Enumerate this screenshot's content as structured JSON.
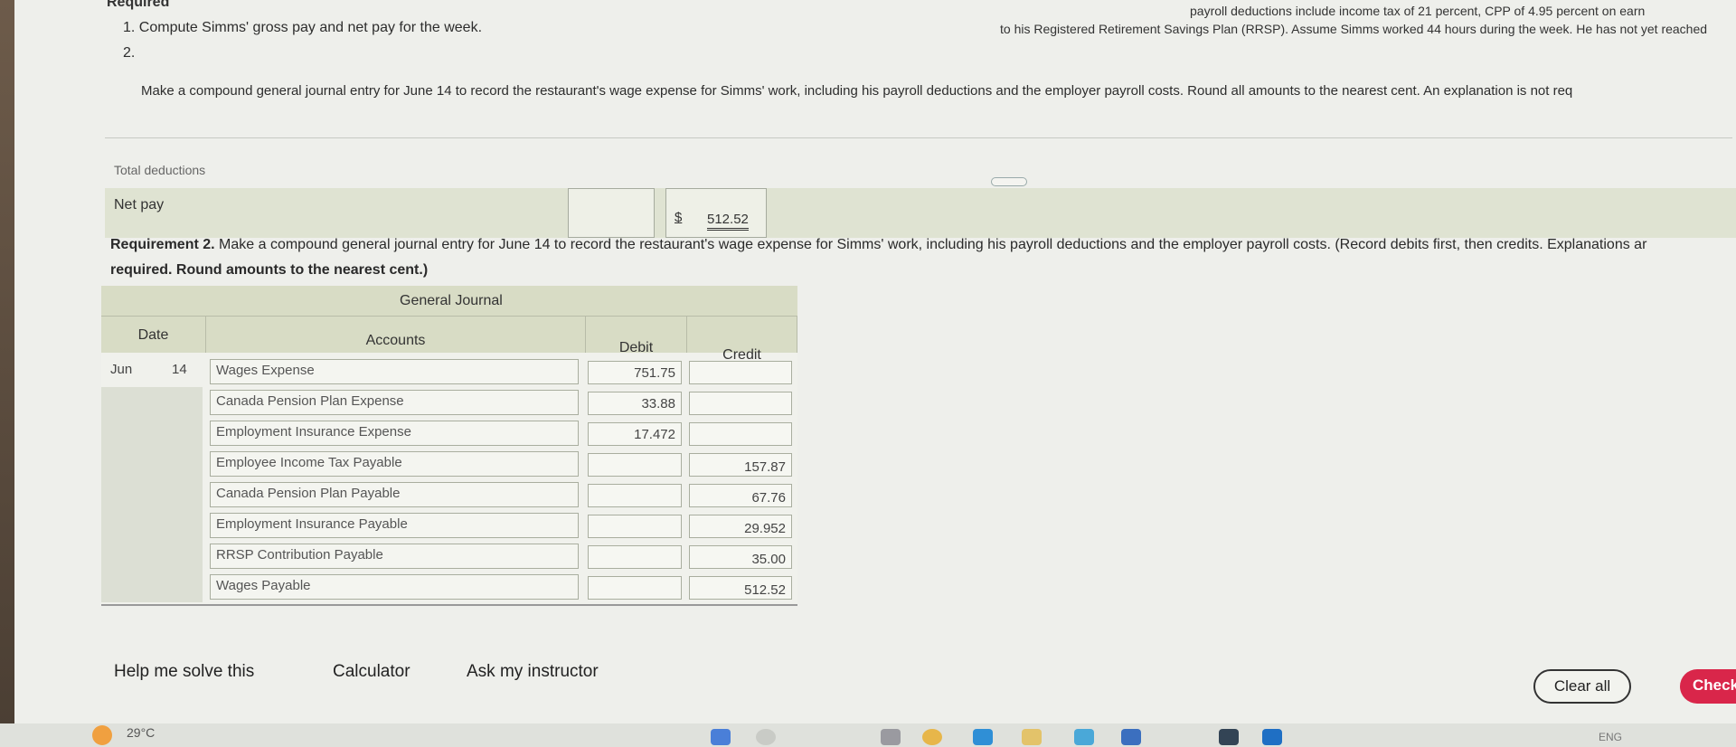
{
  "header": {
    "required": "Required",
    "top_right_line1": "payroll deductions include income tax of 21 percent, CPP of 4.95 percent on earn",
    "top_right_line2": "to his Registered Retirement Savings Plan (RRSP). Assume Simms worked 44 hours during the week. He has not yet reached",
    "item1": "1. Compute Simms' gross pay and net pay for the week.",
    "item2_num": "2.",
    "item2_text": "Make a compound general journal entry for June 14 to record the restaurant's wage expense for Simms' work, including his payroll deductions and the employer payroll costs. Round all amounts to the nearest cent. An explanation is not req"
  },
  "net_pay": {
    "total_deductions_label": "Total deductions",
    "label": "Net pay",
    "currency": "$",
    "value": "512.52"
  },
  "requirement2": {
    "prefix": "Requirement 2.",
    "text": " Make a compound general journal entry for June 14 to record the restaurant's wage expense for Simms' work, including his payroll deductions and the employer payroll costs. (Record debits first, then credits. Explanations ar",
    "line2": "required. Round amounts to the nearest cent.)"
  },
  "journal": {
    "title": "General Journal",
    "columns": {
      "date": "Date",
      "accounts": "Accounts",
      "debit": "Debit",
      "credit": "Credit"
    },
    "rows": [
      {
        "month": "Jun",
        "day": "14",
        "account": "Wages Expense",
        "debit": "751.75",
        "credit": ""
      },
      {
        "month": "",
        "day": "",
        "account": "Canada Pension Plan Expense",
        "debit": "33.88",
        "credit": ""
      },
      {
        "month": "",
        "day": "",
        "account": "Employment Insurance Expense",
        "debit": "17.472",
        "credit": ""
      },
      {
        "month": "",
        "day": "",
        "account": "Employee Income Tax Payable",
        "debit": "",
        "credit": "157.87"
      },
      {
        "month": "",
        "day": "",
        "account": "Canada Pension Plan Payable",
        "debit": "",
        "credit": "67.76"
      },
      {
        "month": "",
        "day": "",
        "account": "Employment Insurance Payable",
        "debit": "",
        "credit": "29.952"
      },
      {
        "month": "",
        "day": "",
        "account": "RRSP Contribution Payable",
        "debit": "",
        "credit": "35.00"
      },
      {
        "month": "",
        "day": "",
        "account": "Wages Payable",
        "debit": "",
        "credit": "512.52"
      }
    ]
  },
  "actions": {
    "help": "Help me solve this",
    "calculator": "Calculator",
    "ask": "Ask my instructor",
    "clear_all": "Clear all",
    "check": "Check"
  },
  "taskbar": {
    "temperature": "29°C",
    "language": "ENG"
  },
  "colors": {
    "check_button": "#d9264a",
    "header_band": "#d8dcc5"
  }
}
